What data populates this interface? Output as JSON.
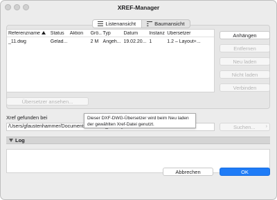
{
  "window": {
    "title": "XREF-Manager"
  },
  "view_tabs": [
    {
      "label": "Listenansicht",
      "icon": "list-icon",
      "active": true
    },
    {
      "label": "Baumansicht",
      "icon": "tree-icon",
      "active": false
    }
  ],
  "table": {
    "columns": [
      "Referenzname",
      "Status",
      "Aktion",
      "Grö...",
      "Typ",
      "Datum",
      "Instanz",
      "Übersetzer"
    ],
    "sorted_column": "Referenzname",
    "rows": [
      [
        "_11.dwg",
        "Gelad...",
        "",
        "2 M",
        "Angeh...",
        "19.02.20...",
        "1",
        "1.2 – Layout+..."
      ]
    ]
  },
  "side_buttons": {
    "attach": "Anhängen",
    "remove": "Entfernen",
    "reload_new": "Neu laden",
    "no_reload": "Nicht laden",
    "bind": "Verbinden"
  },
  "translator_button": "Übersetzer ansehen...",
  "xref_found": {
    "label": "Xref gefunden bei",
    "path": "/Users/gfaustenhammer/Documents/Kunden/_11.dwg",
    "search_button": "Suchen...",
    "chevron": "›"
  },
  "tooltip": {
    "text": "Dieser DXF-DWG-Übersetzer wird beim Neu laden der gewählten Xref-Datei genutzt."
  },
  "log": {
    "title": "Log",
    "content": ""
  },
  "footer": {
    "cancel": "Abbrechen",
    "ok": "OK"
  },
  "colors": {
    "accent": "#1f7cf7",
    "window_bg": "#ececec"
  }
}
